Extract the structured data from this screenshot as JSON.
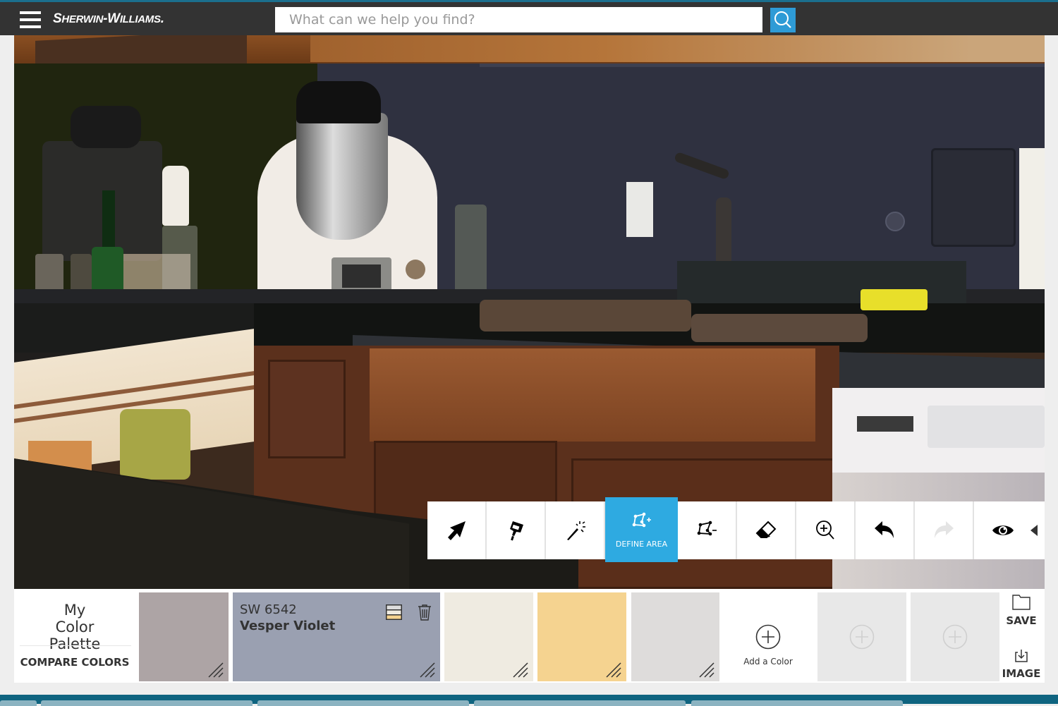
{
  "header": {
    "brand": "Sherwin-Williams.",
    "search_placeholder": "What can we help you find?",
    "search_value": "",
    "menu_icon": "hamburger-menu-icon",
    "search_icon": "search-icon",
    "accent_color": "#2e9bd6"
  },
  "toolbar": {
    "tools": [
      {
        "name": "select",
        "icon": "arrow-pointer-icon",
        "label": "",
        "active": false
      },
      {
        "name": "paint",
        "icon": "paint-brush-icon",
        "label": "",
        "active": false
      },
      {
        "name": "magic-wand",
        "icon": "magic-wand-icon",
        "label": "",
        "active": false
      },
      {
        "name": "define-area",
        "icon": "polygon-add-icon",
        "label": "DEFINE AREA",
        "active": true
      },
      {
        "name": "remove-area",
        "icon": "polygon-remove-icon",
        "label": "",
        "active": false
      },
      {
        "name": "erase",
        "icon": "eraser-icon",
        "label": "",
        "active": false
      },
      {
        "name": "zoom",
        "icon": "zoom-in-icon",
        "label": "",
        "active": false
      },
      {
        "name": "undo",
        "icon": "undo-icon",
        "label": "",
        "active": false
      },
      {
        "name": "redo",
        "icon": "redo-icon",
        "label": "",
        "active": false,
        "disabled": true
      },
      {
        "name": "preview",
        "icon": "eye-icon",
        "label": "",
        "active": false
      }
    ],
    "collapse_icon": "caret-left-icon",
    "active_color": "#2eaae1"
  },
  "palette": {
    "title": "My Color Palette",
    "compare_label": "COMPARE COLORS",
    "swatches": [
      {
        "color": "#ada4a5",
        "code": "",
        "name": ""
      },
      {
        "color": "#9aa0b1",
        "code": "SW 6542",
        "name": "Vesper Violet",
        "selected": true
      },
      {
        "color": "#efebe1",
        "code": "",
        "name": ""
      },
      {
        "color": "#f5d390",
        "code": "",
        "name": ""
      },
      {
        "color": "#dedcdb",
        "code": "",
        "name": ""
      }
    ],
    "add_color_label": "Add a Color",
    "empty_slot_color": "#e8e8e8",
    "save_label": "SAVE",
    "image_label": "IMAGE"
  }
}
